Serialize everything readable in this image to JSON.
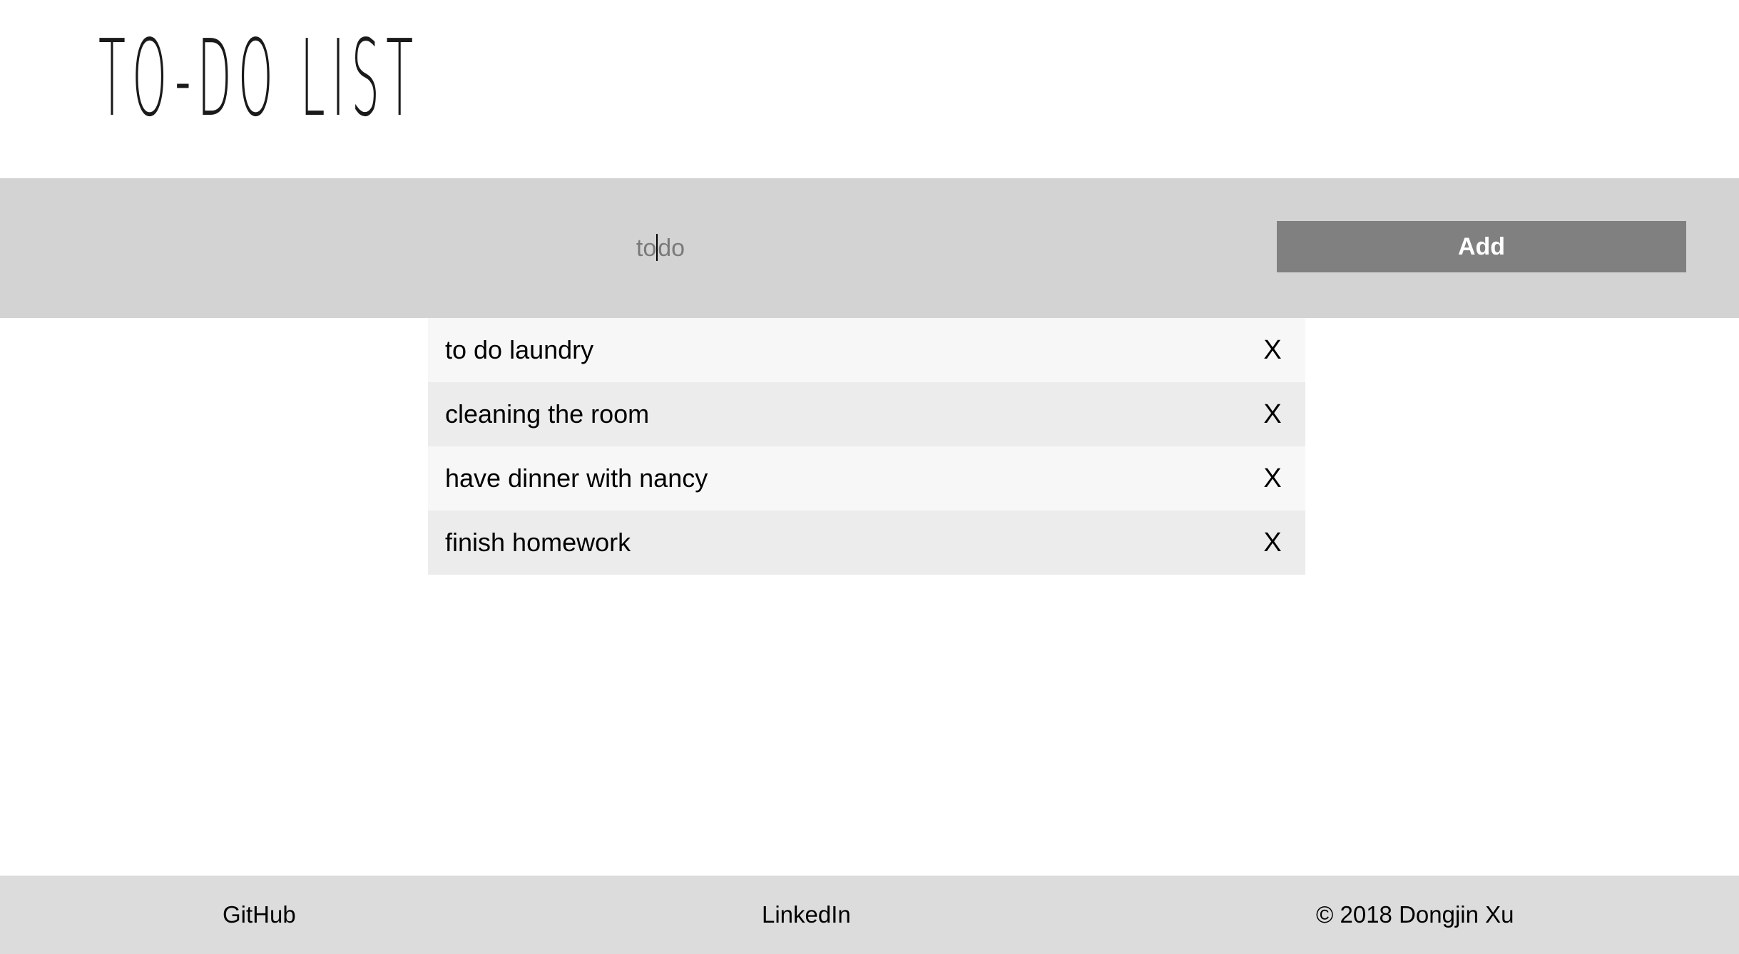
{
  "header": {
    "title": "TO-DO LIST"
  },
  "input": {
    "value_before_caret": "to",
    "value_after_caret": "do",
    "value": "todo"
  },
  "add_button": {
    "label": "Add"
  },
  "todos": [
    {
      "text": "to do laundry",
      "delete_label": "X"
    },
    {
      "text": "cleaning the room",
      "delete_label": "X"
    },
    {
      "text": "have dinner with nancy",
      "delete_label": "X"
    },
    {
      "text": "finish homework",
      "delete_label": "X"
    }
  ],
  "footer": {
    "github": "GitHub",
    "linkedin": "LinkedIn",
    "copyright": "© 2018 Dongjin Xu"
  },
  "colors": {
    "input_bar_bg": "#d3d3d3",
    "add_button_bg": "#808080",
    "row_odd_bg": "#f7f7f7",
    "row_even_bg": "#ececec",
    "footer_bg": "#dcdcdc"
  }
}
